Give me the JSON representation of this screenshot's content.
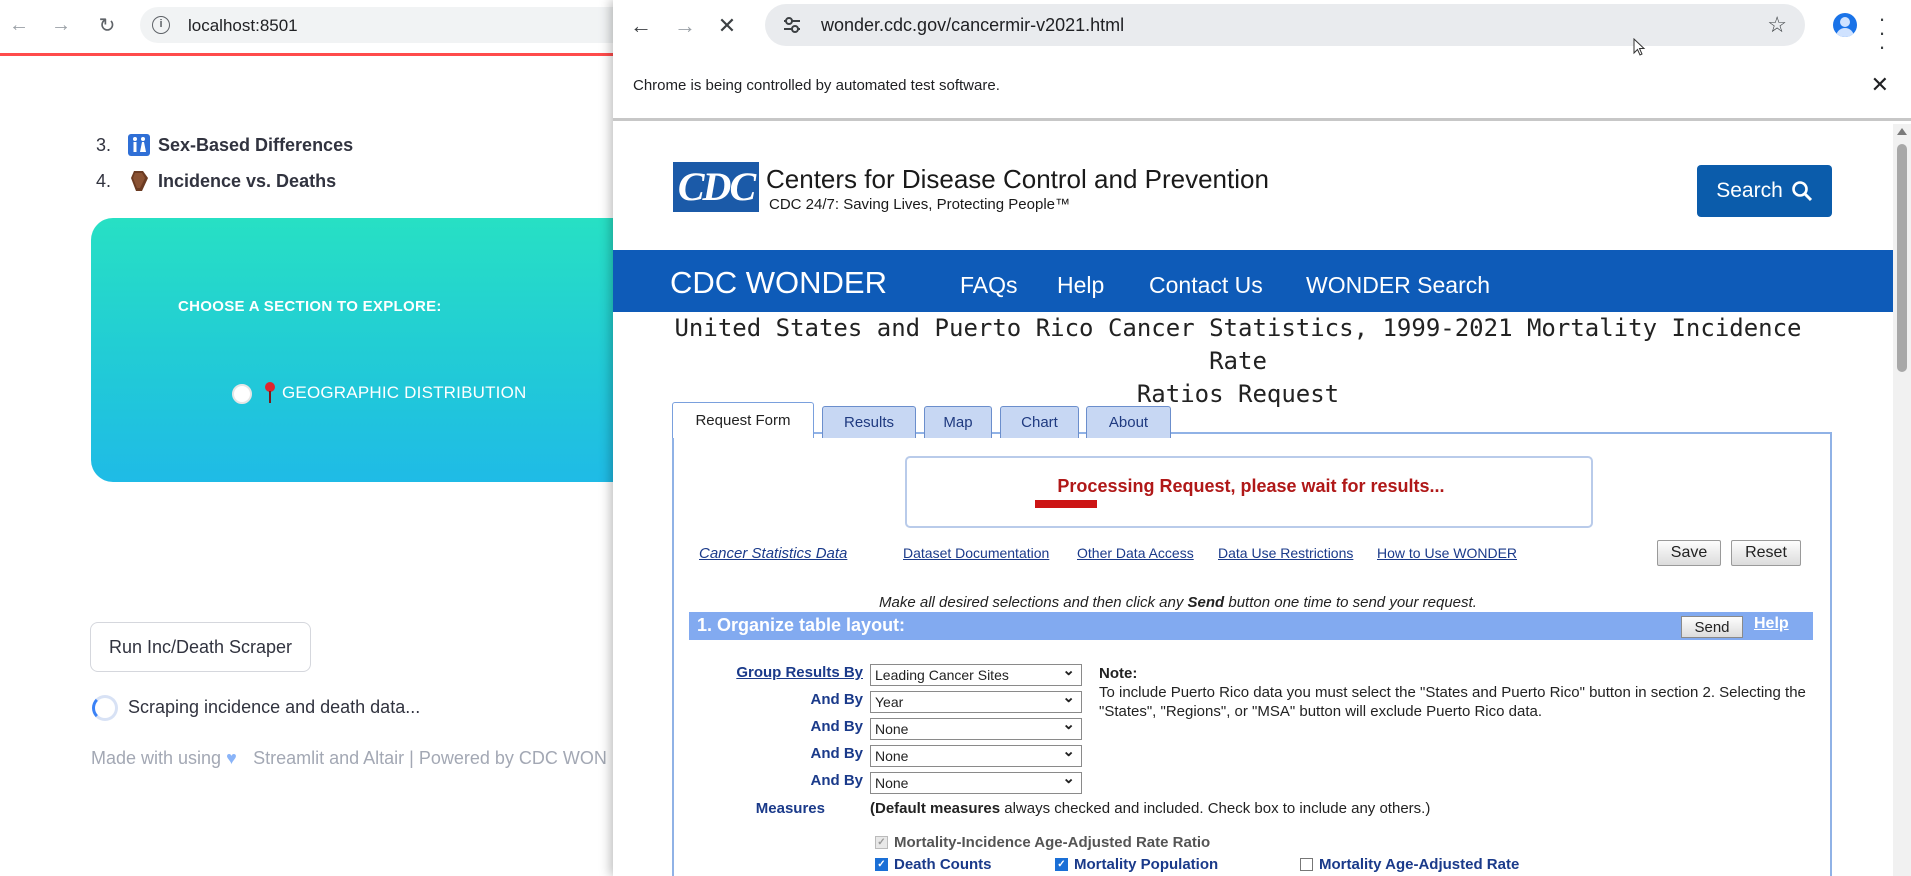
{
  "left_browser": {
    "url": "localhost:8501",
    "section_list": [
      {
        "num": "3.",
        "label": "Sex-Based Differences",
        "icon": "restroom-icon"
      },
      {
        "num": "4.",
        "label": "Incidence vs. Deaths",
        "icon": "coffin-icon"
      }
    ],
    "hero": {
      "choose_label": "CHOOSE A SECTION TO EXPLORE:",
      "option_label": "GEOGRAPHIC DISTRIBUTION"
    },
    "run_button": "Run Inc/Death Scraper",
    "status": "Scraping incidence and death data...",
    "footer_prefix": "Made with using",
    "footer_suffix": "Streamlit and Altair | Powered by CDC WON"
  },
  "right_browser": {
    "url": "wonder.cdc.gov/cancermir-v2021.html",
    "infobar": "Chrome is being controlled by automated test software.",
    "cdc": {
      "logo": "CDC",
      "name": "Centers for Disease Control and Prevention",
      "tagline": "CDC 24/7: Saving Lives, Protecting People™",
      "search_label": "Search"
    },
    "nav": {
      "brand": "CDC WONDER",
      "links": [
        "FAQs",
        "Help",
        "Contact Us",
        "WONDER Search"
      ]
    },
    "page_title_line1": "United States and Puerto Rico Cancer Statistics, 1999-2021 Mortality Incidence Rate",
    "page_title_line2": "Ratios Request",
    "tabs": [
      "Request Form",
      "Results",
      "Map",
      "Chart",
      "About"
    ],
    "processing": "Processing Request, please wait for results...",
    "doc_links": [
      "Cancer Statistics Data",
      "Dataset Documentation",
      "Other Data Access",
      "Data Use Restrictions",
      "How to Use WONDER"
    ],
    "save_label": "Save",
    "reset_label": "Reset",
    "instructions_pre": "Make all desired selections and then click any",
    "instructions_bold": "Send",
    "instructions_post": "button one time to send your request.",
    "section1": {
      "title": "1. Organize table layout:",
      "send": "Send",
      "help": "Help"
    },
    "group_by": [
      {
        "label": "Group Results By",
        "value": "Leading Cancer Sites"
      },
      {
        "label": "And By",
        "value": "Year"
      },
      {
        "label": "And By",
        "value": "None"
      },
      {
        "label": "And By",
        "value": "None"
      },
      {
        "label": "And By",
        "value": "None"
      }
    ],
    "note_title": "Note:",
    "note_body": "To include Puerto Rico data you must select the \"States and Puerto Rico\" button in section 2. Selecting the \"States\", \"Regions\", or \"MSA\" button will exclude Puerto Rico data.",
    "measures_label": "Measures",
    "measures_pre": "(Default measures",
    "measures_post": "always checked and included. Check box to include any others.)",
    "measures": [
      {
        "label": "Mortality-Incidence Age-Adjusted Rate Ratio",
        "state": "disabled"
      },
      {
        "label": "Death Counts",
        "state": "checked"
      },
      {
        "label": "Mortality Population",
        "state": "checked"
      },
      {
        "label": "Mortality Age-Adjusted Rate",
        "state": "unchecked"
      }
    ]
  }
}
